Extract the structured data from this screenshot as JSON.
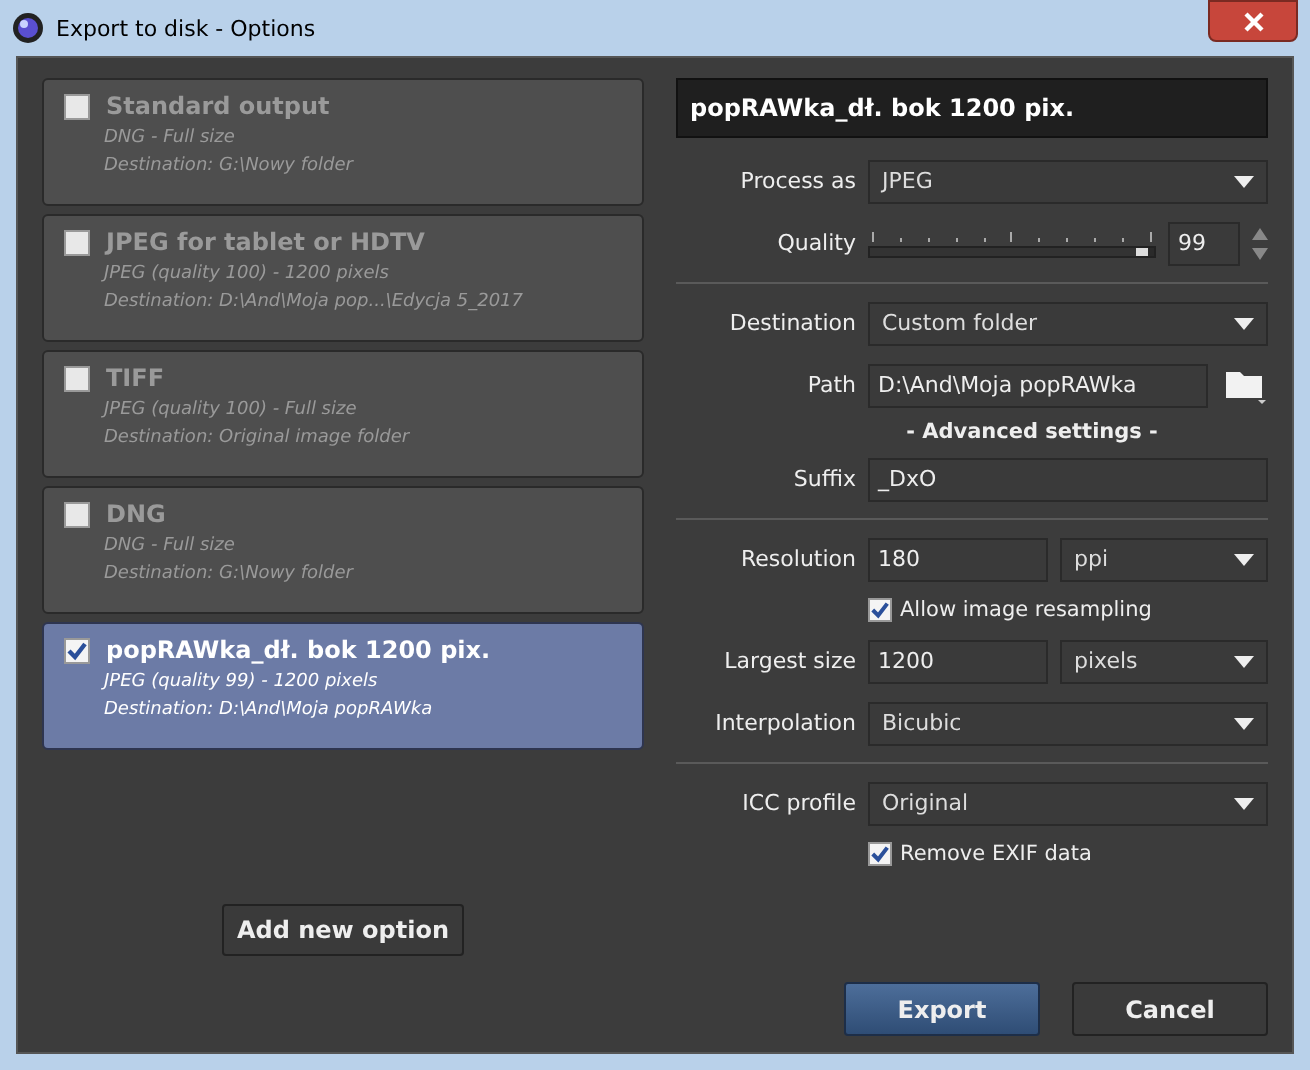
{
  "window": {
    "title": "Export to disk - Options"
  },
  "options": [
    {
      "name": "Standard output",
      "format": "DNG  -  Full size",
      "destination": "Destination: G:\\Nowy folder",
      "checked": false,
      "selected": false
    },
    {
      "name": "JPEG for tablet or HDTV",
      "format": "JPEG (quality 100)  -  1200 pixels",
      "destination": "Destination: D:\\And\\Moja pop...\\Edycja 5_2017",
      "checked": false,
      "selected": false
    },
    {
      "name": "TIFF",
      "format": "JPEG (quality 100)  -  Full size",
      "destination": "Destination: Original image folder",
      "checked": false,
      "selected": false
    },
    {
      "name": "DNG",
      "format": "DNG  -  Full size",
      "destination": "Destination: G:\\Nowy folder",
      "checked": false,
      "selected": false
    },
    {
      "name": "popRAWka_dł. bok 1200 pix.",
      "format": "JPEG (quality 99)  -  1200 pixels",
      "destination": "Destination: D:\\And\\Moja popRAWka",
      "checked": true,
      "selected": true
    }
  ],
  "add_button": "Add new option",
  "settings": {
    "name_field": "popRAWka_dł. bok 1200 pix.",
    "rows": [
      {
        "kind": "select",
        "label": "Process as",
        "value": "JPEG"
      },
      {
        "kind": "slider",
        "label": "Quality",
        "level": 0.98,
        "value": "99"
      },
      {
        "kind": "divider"
      },
      {
        "kind": "select",
        "label": "Destination",
        "value": "Custom folder"
      },
      {
        "kind": "path",
        "label": "Path",
        "value": "D:\\And\\Moja popRAWka"
      },
      {
        "kind": "heading",
        "label": "- Advanced settings -"
      },
      {
        "kind": "text",
        "label": "Suffix",
        "value": "_DxO"
      },
      {
        "kind": "divider"
      },
      {
        "kind": "unit",
        "label": "Resolution",
        "value": "180",
        "unit": "ppi"
      },
      {
        "kind": "check",
        "label": "Allow image resampling",
        "checked": true
      },
      {
        "kind": "unit",
        "label": "Largest size",
        "value": "1200",
        "unit": "pixels"
      },
      {
        "kind": "select",
        "label": "Interpolation",
        "value": "Bicubic"
      },
      {
        "kind": "divider"
      },
      {
        "kind": "select",
        "label": "ICC profile",
        "value": "Original"
      },
      {
        "kind": "check",
        "label": "Remove EXIF data",
        "checked": true
      }
    ]
  },
  "buttons": [
    {
      "label": "Export",
      "kind": "primary"
    },
    {
      "label": "Cancel",
      "kind": "normal"
    }
  ]
}
